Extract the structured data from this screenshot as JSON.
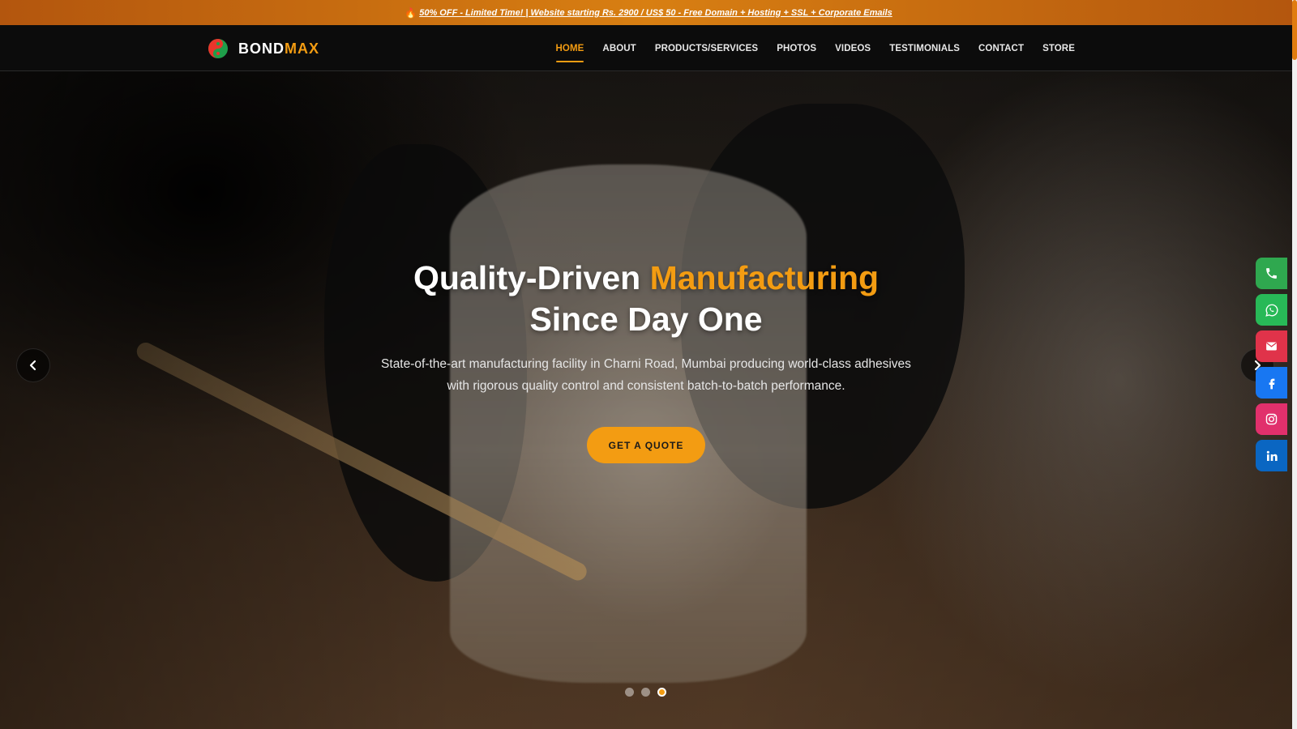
{
  "promo": {
    "text": "50% OFF - Limited Time! | Website starting Rs. 2900 / US$ 50 - Free Domain + Hosting + SSL + Corporate Emails",
    "icon": "flame-icon"
  },
  "brand": {
    "name_part1": "BOND",
    "name_part2": "MAX"
  },
  "nav": {
    "items": [
      {
        "label": "HOME",
        "active": true
      },
      {
        "label": "ABOUT"
      },
      {
        "label": "PRODUCTS/SERVICES"
      },
      {
        "label": "PHOTOS"
      },
      {
        "label": "VIDEOS"
      },
      {
        "label": "TESTIMONIALS"
      },
      {
        "label": "CONTACT"
      },
      {
        "label": "STORE"
      }
    ]
  },
  "hero": {
    "title_part1": "Quality-Driven",
    "title_accent": "Manufacturing",
    "title_line2": "Since Day One",
    "subtitle_line1": "State-of-the-art manufacturing facility in Charni Road, Mumbai producing world-class adhesives",
    "subtitle_line2": "with rigorous quality control and consistent batch-to-batch performance.",
    "cta_label": "GET A QUOTE",
    "slides": {
      "count": 3,
      "active_index": 3
    }
  },
  "social": [
    "phone-icon",
    "whatsapp-icon",
    "email-icon",
    "facebook-icon",
    "instagram-icon",
    "linkedin-icon"
  ],
  "colors": {
    "accent": "#f39c12",
    "promo_bar": "#c8690f",
    "header_bg": "#0c0c0c",
    "phone": "#2fa84f",
    "whatsapp": "#28b957",
    "email": "#e0334a",
    "facebook": "#1877f2",
    "instagram": "#e1306c",
    "linkedin": "#0a66c2"
  }
}
